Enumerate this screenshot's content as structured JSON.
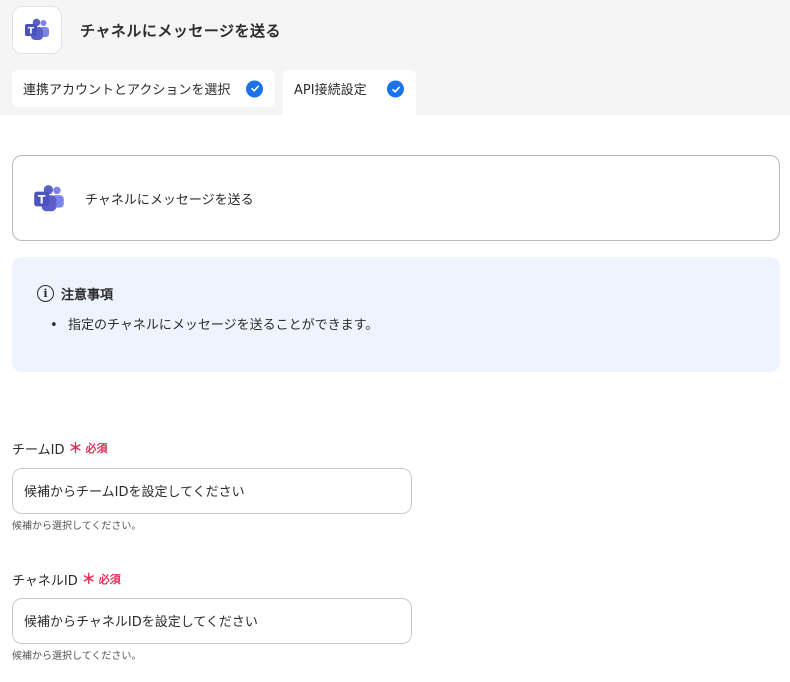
{
  "header": {
    "app_icon": "microsoft-teams-icon",
    "title": "チャネルにメッセージを送る"
  },
  "tabs": [
    {
      "label": "連携アカウントとアクションを選択",
      "completed": true
    },
    {
      "label": "API接続設定",
      "completed": true,
      "active": true
    }
  ],
  "action": {
    "icon": "microsoft-teams-icon",
    "label": "チャネルにメッセージを送る"
  },
  "notice": {
    "icon": "info-icon",
    "title": "注意事項",
    "items": [
      "指定のチャネルにメッセージを送ることができます。"
    ]
  },
  "fields": [
    {
      "label": "チームID",
      "required_mark": "＊",
      "required_text": "必須",
      "placeholder": "候補からチームIDを設定してください",
      "help": "候補から選択してください。"
    },
    {
      "label": "チャネルID",
      "required_mark": "＊",
      "required_text": "必須",
      "placeholder": "候補からチャネルIDを設定してください",
      "help": "候補から選択してください。"
    }
  ],
  "colors": {
    "accent": "#1a73e8",
    "required": "#e0315b",
    "notice_bg": "#edf4fd",
    "teams_purple": "#5b5fc7"
  }
}
